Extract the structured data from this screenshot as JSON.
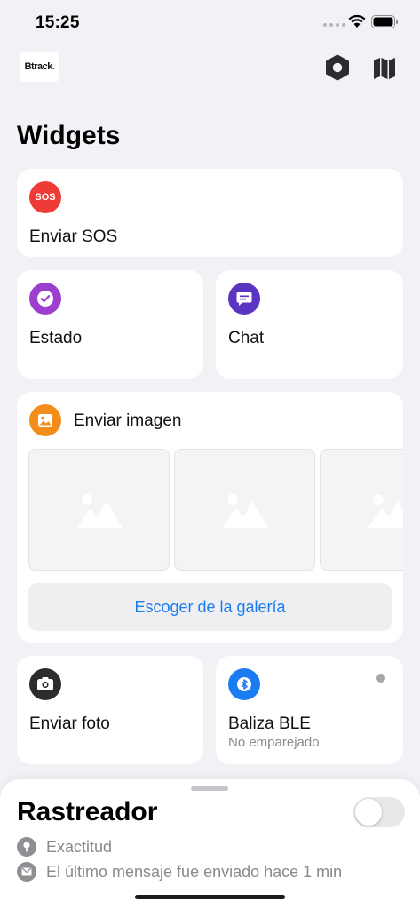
{
  "status_bar": {
    "time": "15:25"
  },
  "header": {
    "logo_text_main": "Btrack",
    "logo_text_accent": ".",
    "settings_icon": "hexagon-gear-icon",
    "map_icon": "map-icon"
  },
  "page_title": "Widgets",
  "widgets": {
    "sos": {
      "icon_text": "SOS",
      "title": "Enviar SOS",
      "color": "#ef3b35"
    },
    "status": {
      "title": "Estado",
      "icon": "check-circle-icon",
      "color": "#9c3fcf"
    },
    "chat": {
      "title": "Chat",
      "icon": "chat-bubble-icon",
      "color": "#5b35c2"
    },
    "send_image": {
      "title": "Enviar imagen",
      "icon": "photo-icon",
      "color": "#f28c1a",
      "gallery_button": "Escoger de la galería"
    },
    "send_photo": {
      "title": "Enviar foto",
      "icon": "camera-icon",
      "color": "#2c2c2e"
    },
    "ble_beacon": {
      "title": "Baliza BLE",
      "subtitle": "No emparejado",
      "icon": "bluetooth-icon",
      "color": "#1a7cf0"
    }
  },
  "tracker_sheet": {
    "title": "Rastreador",
    "toggle_on": false,
    "accuracy_label": "Exactitud",
    "last_message_label": "El último mensaje fue enviado hace 1 min"
  },
  "accent_color": "#1a7cf0"
}
